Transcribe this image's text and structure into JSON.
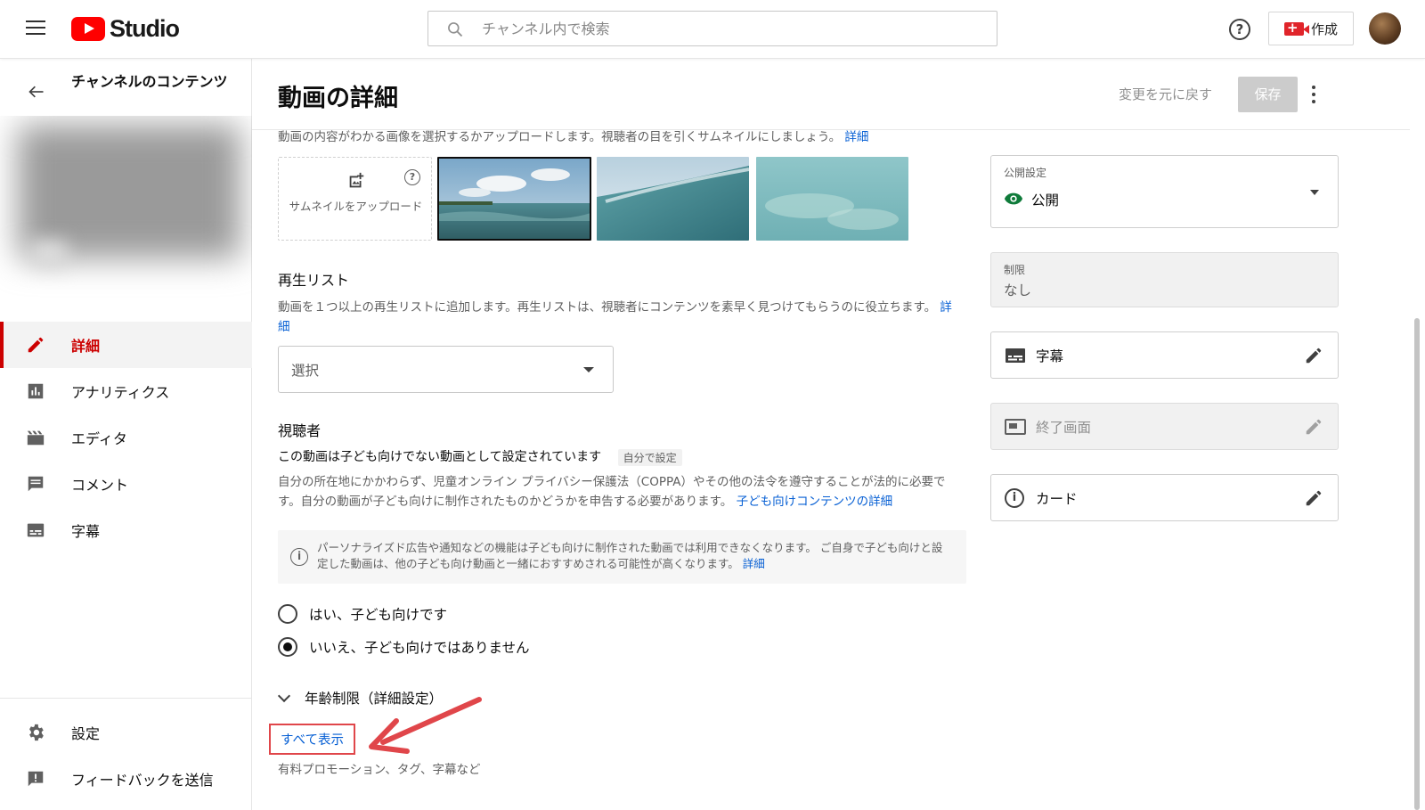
{
  "topbar": {
    "logo_text": "Studio",
    "search_placeholder": "チャンネル内で検索",
    "help_glyph": "?",
    "create_label": "作成"
  },
  "sidebar": {
    "title": "チャンネルのコンテンツ",
    "nav": [
      {
        "label": "詳細",
        "icon": "pencil-icon",
        "active": true
      },
      {
        "label": "アナリティクス",
        "icon": "analytics-icon"
      },
      {
        "label": "エディタ",
        "icon": "clapperboard-icon"
      },
      {
        "label": "コメント",
        "icon": "comment-icon"
      },
      {
        "label": "字幕",
        "icon": "subtitles-icon"
      }
    ],
    "bottom": [
      {
        "label": "設定",
        "icon": "gear-icon"
      },
      {
        "label": "フィードバックを送信",
        "icon": "feedback-icon"
      }
    ]
  },
  "header": {
    "title": "動画の詳細",
    "undo_label": "変更を元に戻す",
    "save_label": "保存"
  },
  "thumbnail": {
    "description": "動画の内容がわかる画像を選択するかアップロードします。視聴者の目を引くサムネイルにしましょう。",
    "learn_more": "詳細",
    "upload_label": "サムネイルをアップロード",
    "help_glyph": "?"
  },
  "playlist": {
    "title": "再生リスト",
    "description": "動画を１つ以上の再生リストに追加します。再生リストは、視聴者にコンテンツを素早く見つけてもらうのに役立ちます。",
    "learn_more": "詳細",
    "select_value": "選択"
  },
  "audience": {
    "title": "視聴者",
    "status": "この動画は子ども向けでない動画として設定されています",
    "badge": "自分で設定",
    "description": "自分の所在地にかかわらず、児童オンライン プライバシー保護法（COPPA）やその他の法令を遵守することが法的に必要です。自分の動画が子ども向けに制作されたものかどうかを申告する必要があります。",
    "learn_more": "子ども向けコンテンツの詳細",
    "info_glyph": "i",
    "info": "パーソナライズド広告や通知などの機能は子ども向けに制作された動画では利用できなくなります。 ご自身で子ども向けと設定した動画は、他の子ども向け動画と一緒におすすめされる可能性が高くなります。",
    "info_link": "詳細",
    "option_yes": "はい、子ども向けです",
    "option_no": "いいえ、子ども向けではありません",
    "selected": "no"
  },
  "advanced": {
    "age_restriction": "年齢制限（詳細設定）",
    "show_all": "すべて表示",
    "show_all_sub": "有料プロモーション、タグ、字幕など"
  },
  "right_panel": {
    "visibility_label": "公開設定",
    "visibility_value": "公開",
    "restriction_label": "制限",
    "restriction_value": "なし",
    "subtitles": "字幕",
    "end_screen": "終了画面",
    "info_glyph": "i",
    "cards": "カード"
  },
  "colors": {
    "accent_red": "#cc0000",
    "link_blue": "#065fd4",
    "visibility_green": "#0f7b3a",
    "highlight_red": "#e0464a"
  }
}
